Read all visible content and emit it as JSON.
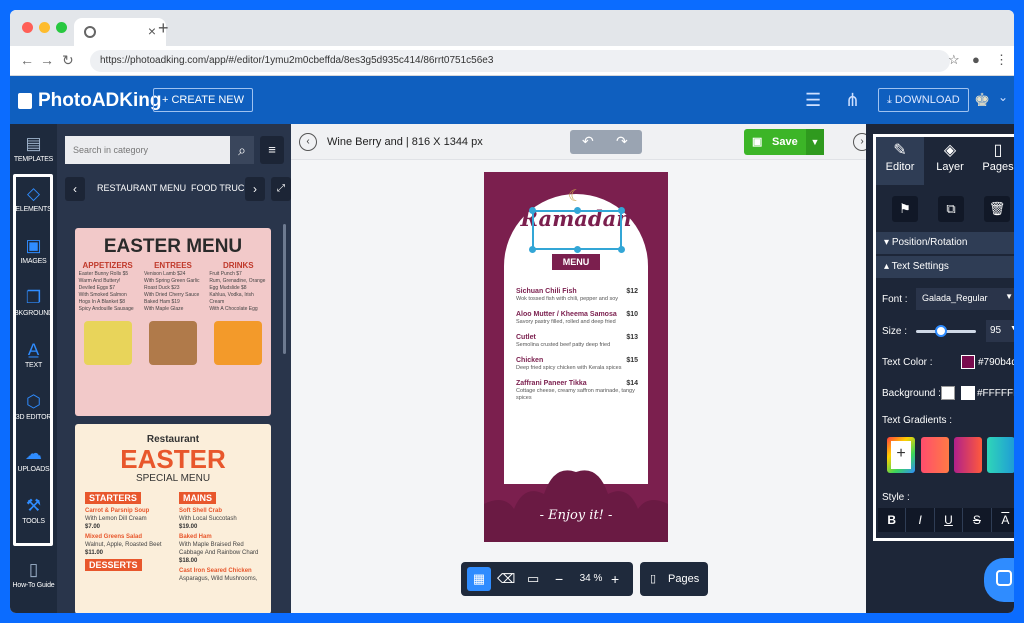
{
  "browser": {
    "tab_close": "×",
    "new_tab": "+",
    "url": "https://photoadking.com/app/#/editor/1ymu2m0cbeffda/8es3g5d935c414/86rrt0751c56e3"
  },
  "header": {
    "logo": "PhotoADKing",
    "create_new": "+ CREATE NEW",
    "download": "DOWNLOAD"
  },
  "rail": [
    {
      "label": "TEMPLATES",
      "icon": "templates-icon"
    },
    {
      "label": "ELEMENTS",
      "icon": "elements-icon"
    },
    {
      "label": "IMAGES",
      "icon": "images-icon"
    },
    {
      "label": "BKGROUND",
      "icon": "background-icon"
    },
    {
      "label": "TEXT",
      "icon": "text-icon"
    },
    {
      "label": "3D EDITOR",
      "icon": "cube-icon"
    },
    {
      "label": "UPLOADS",
      "icon": "upload-icon"
    },
    {
      "label": "TOOLS",
      "icon": "tools-icon"
    },
    {
      "label": "How-To Guide",
      "icon": "guide-icon"
    }
  ],
  "panel": {
    "search_placeholder": "Search in category",
    "categories": [
      "RESTAURANT MENU",
      "FOOD TRUCK"
    ]
  },
  "template1": {
    "title": "EASTER MENU",
    "cols": [
      {
        "head": "APPETIZERS",
        "lines": [
          "Easter Bunny Rolls $5",
          "Warm And Buttery!",
          "Deviled Eggs $7",
          "With Smoked Salmon",
          "Hogs In A Blanket $8",
          "Spicy Andouille Sausage"
        ]
      },
      {
        "head": "ENTREES",
        "lines": [
          "Venison Lamb $24",
          "With Spring Green Garlic",
          "Roast Duck $23",
          "With Dried Cherry Sauce",
          "Baked Ham $19",
          "With Maple Glaze"
        ]
      },
      {
        "head": "DRINKS",
        "lines": [
          "Fruit Punch $7",
          "Rum, Grenadine, Orange",
          "Egg Mudslide $8",
          "Kahlua, Vodka, Irish Cream",
          "With A Chocolate Egg",
          ""
        ]
      }
    ]
  },
  "template2": {
    "restaurant": "Restaurant",
    "title": "EASTER",
    "subtitle": "SPECIAL MENU",
    "left": {
      "tag": "STARTERS",
      "items": [
        {
          "name": "Carrot & Parsnip Soup",
          "desc": "With Lemon Dill Cream",
          "price": "$7.00"
        },
        {
          "name": "Mixed Greens Salad",
          "desc": "Walnut, Apple, Roasted Beet",
          "price": "$11.00"
        }
      ],
      "tag2": "DESSERTS"
    },
    "right": {
      "tag": "MAINS",
      "items": [
        {
          "name": "Soft Shell Crab",
          "desc": "With Local Succotash",
          "price": "$19.00"
        },
        {
          "name": "Baked Ham",
          "desc": "With Maple Braised Red Cabbage And Rainbow Chard",
          "price": "$18.00"
        },
        {
          "name": "Cast Iron Seared Chicken",
          "desc": "Asparagus, Wild Mushrooms,",
          "price": ""
        }
      ]
    }
  },
  "toolbar": {
    "doc_title": "Wine Berry and | 816 X 1344 px",
    "save": "Save"
  },
  "poster": {
    "title": "Ramadan",
    "menu": "MENU",
    "items": [
      {
        "name": "Sichuan Chili Fish",
        "price": "$12",
        "desc": "Wok tossed fish with chili, pepper and soy"
      },
      {
        "name": "Aloo Mutter / Kheema Samosa",
        "price": "$10",
        "desc": "Savory pastry filled, rolled and deep fried"
      },
      {
        "name": "Cutlet",
        "price": "$13",
        "desc": "Semolina crusted beef patty deep fried"
      },
      {
        "name": "Chicken",
        "price": "$15",
        "desc": "Deep fried spicy chicken with Kerala spices"
      },
      {
        "name": "Zaffrani Paneer Tikka",
        "price": "$14",
        "desc": "Cottage cheese, creamy saffron marinade, tangy spices"
      }
    ],
    "footer": "- Enjoy it! -",
    "colors": {
      "bg": "#790b4d",
      "arch": "#ffffff"
    }
  },
  "bottom": {
    "zoom": "34 %",
    "pages": "Pages"
  },
  "right": {
    "tabs": [
      "Editor",
      "Layer",
      "Pages"
    ],
    "sections": [
      "Position/Rotation",
      "Text Settings"
    ],
    "font_label": "Font :",
    "font_value": "Galada_Regular",
    "size_label": "Size :",
    "size_value": "95",
    "text_color_label": "Text Color :",
    "text_color": "#790b4d",
    "background_label": "Background :",
    "background_color": "#FFFFFF",
    "gradients_label": "Text Gradients :",
    "style_label": "Style :",
    "styles": [
      "B",
      "I",
      "U",
      "S",
      "A"
    ]
  }
}
